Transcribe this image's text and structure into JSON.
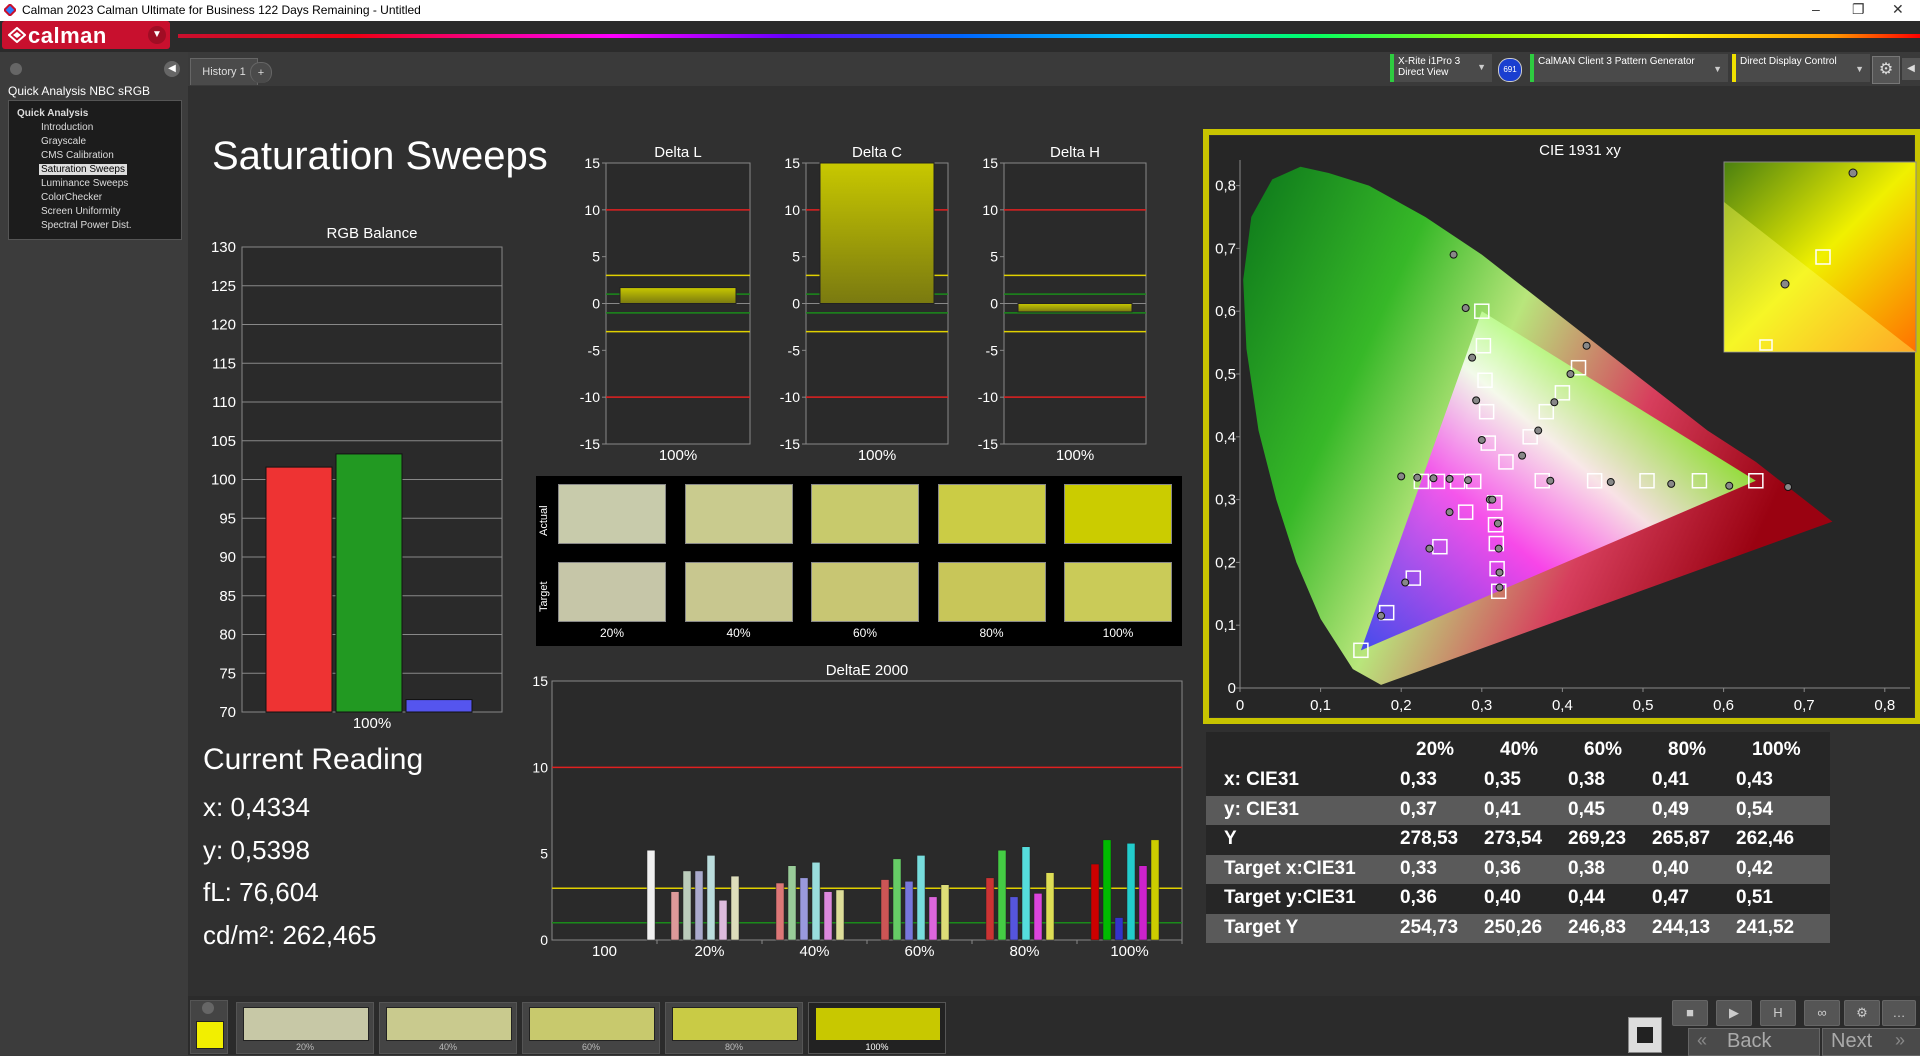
{
  "window": {
    "title": "Calman 2023 Calman Ultimate for Business 122 Days Remaining  - Untitled"
  },
  "app": {
    "logo_text": "calman"
  },
  "nav": {
    "title": "Quick Analysis NBC sRGB",
    "group": "Quick Analysis",
    "items": [
      "Introduction",
      "Grayscale",
      "CMS Calibration",
      "Saturation Sweeps",
      "Luminance Sweeps",
      "ColorChecker",
      "Screen Uniformity",
      "Spectral Power Dist."
    ],
    "selected_index": 3
  },
  "tabs": {
    "history": "History 1",
    "add": "+"
  },
  "devices": [
    {
      "line1": "X-Rite i1Pro 3",
      "line2": "Direct View",
      "color": "#2ecc40"
    },
    {
      "badge": "691"
    },
    {
      "line1": "CalMAN Client 3 Pattern Generator",
      "line2": "",
      "color": "#2ecc40"
    },
    {
      "line1": "Direct Display Control",
      "line2": "",
      "color": "#f0e000"
    }
  ],
  "section": {
    "title": "Saturation Sweeps"
  },
  "current": {
    "heading": "Current Reading",
    "x": "x: 0,4334",
    "y": "y: 0,5398",
    "fl": "fL: 76,604",
    "cdm2": "cd/m²: 262,465"
  },
  "swatch_grid": {
    "row_labels": [
      "Actual",
      "Target"
    ],
    "columns": [
      "20%",
      "40%",
      "60%",
      "80%",
      "100%"
    ],
    "actual_colors": [
      "#c8cbab",
      "#c9cb8e",
      "#c8ca6c",
      "#cbcc45",
      "#cbcc00"
    ],
    "target_colors": [
      "#c6c6a8",
      "#c8c78f",
      "#c8c673",
      "#c8c659",
      "#cacb58"
    ]
  },
  "table": {
    "headers": [
      "20%",
      "40%",
      "60%",
      "80%",
      "100%"
    ],
    "rows": [
      {
        "label": "x: CIE31",
        "values": [
          "0,33",
          "0,35",
          "0,38",
          "0,41",
          "0,43"
        ]
      },
      {
        "label": "y: CIE31",
        "values": [
          "0,37",
          "0,41",
          "0,45",
          "0,49",
          "0,54"
        ]
      },
      {
        "label": "Y",
        "values": [
          "278,53",
          "273,54",
          "269,23",
          "265,87",
          "262,46"
        ]
      },
      {
        "label": "Target x:CIE31",
        "values": [
          "0,33",
          "0,36",
          "0,38",
          "0,40",
          "0,42"
        ]
      },
      {
        "label": "Target y:CIE31",
        "values": [
          "0,36",
          "0,40",
          "0,44",
          "0,47",
          "0,51"
        ]
      },
      {
        "label": "Target Y",
        "values": [
          "254,73",
          "250,26",
          "246,83",
          "244,13",
          "241,52"
        ]
      }
    ]
  },
  "bottom": {
    "thumbs": [
      {
        "label": "20%",
        "color": "#c7c8a6"
      },
      {
        "label": "40%",
        "color": "#c9ca8e"
      },
      {
        "label": "60%",
        "color": "#c8c96d"
      },
      {
        "label": "80%",
        "color": "#c9cb45"
      },
      {
        "label": "100%",
        "color": "#c8c800"
      }
    ],
    "current_swatch": "#f2ef00",
    "back": "Back",
    "next": "Next"
  },
  "chart_data": [
    {
      "type": "bar",
      "title": "RGB Balance",
      "categories": [
        "100%"
      ],
      "series": [
        {
          "values": [
            101.6
          ],
          "color": "#ee3333"
        },
        {
          "values": [
            103.3
          ],
          "color": "#229922"
        },
        {
          "values": [
            71.6
          ],
          "color": "#5555ee"
        }
      ],
      "ylim": [
        70,
        130
      ],
      "yticks": [
        70,
        75,
        80,
        85,
        90,
        95,
        100,
        105,
        110,
        115,
        120,
        125,
        130
      ]
    },
    {
      "type": "bar",
      "title": "Delta L",
      "categories": [
        "100%"
      ],
      "values": [
        1.7
      ],
      "ylim": [
        -15,
        15
      ],
      "yticks": [
        15,
        10,
        5,
        0,
        -5,
        -10,
        -15
      ]
    },
    {
      "type": "bar",
      "title": "Delta C",
      "categories": [
        "100%"
      ],
      "values": [
        15
      ],
      "ylim": [
        -15,
        15
      ],
      "yticks": [
        15,
        10,
        5,
        0,
        -5,
        -10,
        -15
      ]
    },
    {
      "type": "bar",
      "title": "Delta H",
      "categories": [
        "100%"
      ],
      "values": [
        -0.9
      ],
      "ylim": [
        -15,
        15
      ],
      "yticks": [
        15,
        10,
        5,
        0,
        -5,
        -10,
        -15
      ]
    },
    {
      "type": "bar",
      "title": "DeltaE 2000",
      "categories": [
        "100",
        "20%",
        "40%",
        "60%",
        "80%",
        "100%"
      ],
      "ylim": [
        0,
        15
      ],
      "yticks": [
        0,
        5,
        10,
        15
      ],
      "groups": [
        [
          {
            "v": 5.2,
            "c": "#f0f0f0"
          }
        ],
        [
          {
            "v": 2.8,
            "c": "#d99"
          },
          {
            "v": 4.0,
            "c": "#bcb"
          },
          {
            "v": 4.0,
            "c": "#aac"
          },
          {
            "v": 4.9,
            "c": "#bdd"
          },
          {
            "v": 2.3,
            "c": "#dbd"
          },
          {
            "v": 3.7,
            "c": "#ddb"
          }
        ],
        [
          {
            "v": 3.3,
            "c": "#d77"
          },
          {
            "v": 4.3,
            "c": "#9c9"
          },
          {
            "v": 3.6,
            "c": "#99d"
          },
          {
            "v": 4.5,
            "c": "#9dd"
          },
          {
            "v": 2.8,
            "c": "#d8d"
          },
          {
            "v": 2.9,
            "c": "#dd9"
          }
        ],
        [
          {
            "v": 3.5,
            "c": "#c55"
          },
          {
            "v": 4.7,
            "c": "#6c6"
          },
          {
            "v": 3.4,
            "c": "#77d"
          },
          {
            "v": 4.9,
            "c": "#7dd"
          },
          {
            "v": 2.5,
            "c": "#d6d"
          },
          {
            "v": 3.2,
            "c": "#dd7"
          }
        ],
        [
          {
            "v": 3.6,
            "c": "#c33"
          },
          {
            "v": 5.2,
            "c": "#4c4"
          },
          {
            "v": 2.5,
            "c": "#55d"
          },
          {
            "v": 5.4,
            "c": "#5dd"
          },
          {
            "v": 2.7,
            "c": "#d4d"
          },
          {
            "v": 3.9,
            "c": "#dd5"
          }
        ],
        [
          {
            "v": 4.4,
            "c": "#c00"
          },
          {
            "v": 5.8,
            "c": "#0b0"
          },
          {
            "v": 1.3,
            "c": "#33c"
          },
          {
            "v": 5.6,
            "c": "#2cc"
          },
          {
            "v": 4.3,
            "c": "#c2c"
          },
          {
            "v": 5.8,
            "c": "#cc0"
          }
        ]
      ]
    },
    {
      "type": "scatter",
      "title": "CIE 1931 xy",
      "xlim": [
        0,
        0.85
      ],
      "ylim": [
        0,
        0.85
      ],
      "xticks": [
        0,
        0.1,
        0.2,
        0.3,
        0.4,
        0.5,
        0.6,
        0.7,
        0.8
      ],
      "yticks": [
        0,
        0.1,
        0.2,
        0.3,
        0.4,
        0.5,
        0.6,
        0.7,
        0.8
      ],
      "tick_labels": [
        "0",
        "0,1",
        "0,2",
        "0,3",
        "0,4",
        "0,5",
        "0,6",
        "0,7",
        "0,8"
      ],
      "gamut": [
        [
          0.64,
          0.33
        ],
        [
          0.3,
          0.6
        ],
        [
          0.15,
          0.06
        ]
      ],
      "white": [
        0.3127,
        0.329
      ],
      "targets": [
        [
          0.64,
          0.33
        ],
        [
          0.57,
          0.33
        ],
        [
          0.505,
          0.33
        ],
        [
          0.44,
          0.33
        ],
        [
          0.375,
          0.33
        ],
        [
          0.3,
          0.6
        ],
        [
          0.302,
          0.545
        ],
        [
          0.304,
          0.49
        ],
        [
          0.306,
          0.44
        ],
        [
          0.308,
          0.39
        ],
        [
          0.15,
          0.06
        ],
        [
          0.182,
          0.12
        ],
        [
          0.215,
          0.175
        ],
        [
          0.248,
          0.225
        ],
        [
          0.28,
          0.28
        ],
        [
          0.42,
          0.51
        ],
        [
          0.4,
          0.47
        ],
        [
          0.38,
          0.44
        ],
        [
          0.36,
          0.4
        ],
        [
          0.33,
          0.36
        ],
        [
          0.321,
          0.154
        ],
        [
          0.319,
          0.19
        ],
        [
          0.318,
          0.23
        ],
        [
          0.317,
          0.26
        ],
        [
          0.316,
          0.295
        ],
        [
          0.225,
          0.329
        ],
        [
          0.245,
          0.329
        ],
        [
          0.27,
          0.329
        ],
        [
          0.29,
          0.329
        ]
      ],
      "measured": [
        [
          0.68,
          0.32
        ],
        [
          0.607,
          0.322
        ],
        [
          0.535,
          0.325
        ],
        [
          0.46,
          0.328
        ],
        [
          0.385,
          0.33
        ],
        [
          0.265,
          0.69
        ],
        [
          0.28,
          0.605
        ],
        [
          0.288,
          0.526
        ],
        [
          0.293,
          0.458
        ],
        [
          0.3,
          0.395
        ],
        [
          0.175,
          0.115
        ],
        [
          0.205,
          0.168
        ],
        [
          0.235,
          0.222
        ],
        [
          0.26,
          0.28
        ],
        [
          0.31,
          0.3
        ],
        [
          0.43,
          0.545
        ],
        [
          0.41,
          0.5
        ],
        [
          0.39,
          0.455
        ],
        [
          0.37,
          0.41
        ],
        [
          0.35,
          0.37
        ],
        [
          0.322,
          0.16
        ],
        [
          0.322,
          0.184
        ],
        [
          0.321,
          0.222
        ],
        [
          0.32,
          0.262
        ],
        [
          0.313,
          0.3
        ],
        [
          0.2,
          0.337
        ],
        [
          0.22,
          0.335
        ],
        [
          0.24,
          0.334
        ],
        [
          0.26,
          0.333
        ],
        [
          0.283,
          0.331
        ]
      ],
      "inset": {
        "target_box": [
          [
            0.41,
            0.49
          ],
          [
            0.42,
            0.51
          ],
          [
            0.44,
            0.52
          ]
        ],
        "measured_pts": [
          [
            0.45,
            0.56
          ],
          [
            0.43,
            0.54
          ]
        ]
      }
    }
  ]
}
